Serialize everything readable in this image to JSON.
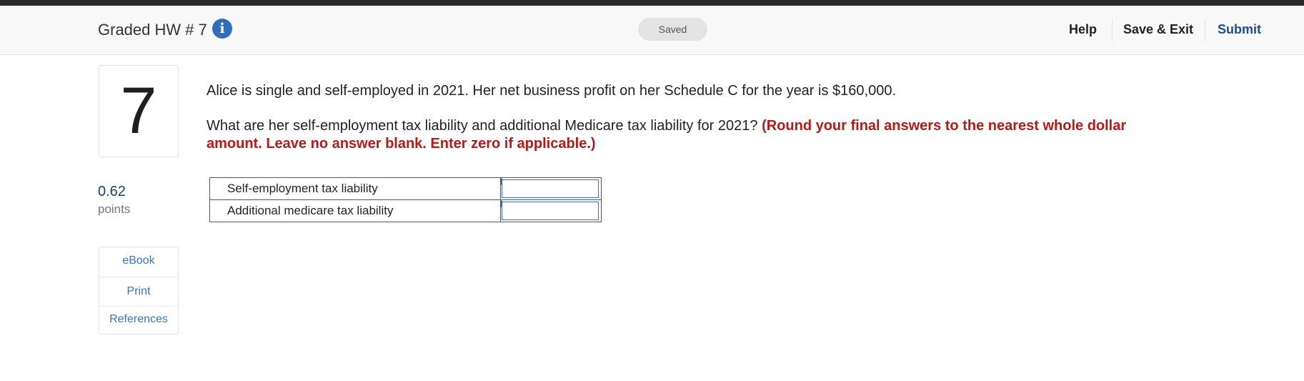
{
  "header": {
    "assignment_title": "Graded HW # 7",
    "info_icon": "info-icon",
    "status": "Saved",
    "help_label": "Help",
    "save_exit_label": "Save & Exit",
    "submit_label": "Submit",
    "colors": {
      "accent": "#2f6fb9",
      "submit": "#1d4f8f"
    }
  },
  "question": {
    "number": "7",
    "points_value": "0.62",
    "points_label": "points",
    "text": "Alice is single and self-employed in 2021. Her net business profit on her Schedule C for the year is $160,000.",
    "prompt": "What are her self-employment tax liability and additional Medicare tax liability for 2021?",
    "instructions": "(Round your final answers to the nearest whole dollar amount. Leave no answer blank. Enter zero if applicable.)",
    "instruction_color": "#b01b1b"
  },
  "tools": {
    "ebook_label": "eBook",
    "print_label": "Print",
    "references_label": "References"
  },
  "answers": [
    {
      "label": "Self-employment tax liability",
      "value": ""
    },
    {
      "label": "Additional medicare tax liability",
      "value": ""
    }
  ]
}
